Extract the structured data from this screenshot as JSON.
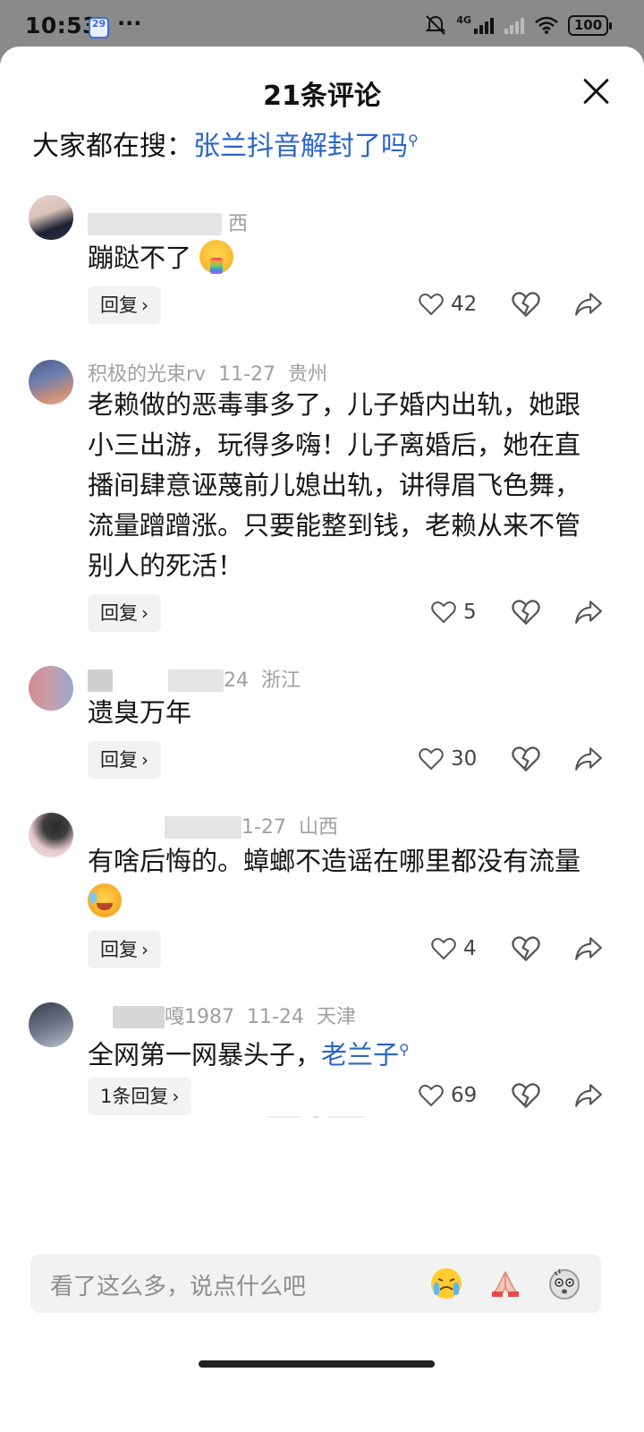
{
  "status_bar": {
    "time": "10:53",
    "calendar_day": "29",
    "dots": "···",
    "network": "4G",
    "battery": "100"
  },
  "sheet": {
    "title": "21条评论"
  },
  "hot_search": {
    "prefix": "大家都在搜：",
    "term": "张兰抖音解封了吗"
  },
  "comments": [
    {
      "meta_visible": "西",
      "text": "蹦跶不了",
      "reply_label": "回复",
      "likes": "42"
    },
    {
      "name_visible": "积极的光束rv",
      "date": "11-27",
      "location": "贵州",
      "text": "老赖做的恶毒事多了，儿子婚内出轨，她跟小三出游，玩得多嗨！儿子离婚后，她在直播间肆意诬蔑前儿媳出轨，讲得眉飞色舞，流量蹭蹭涨。只要能整到钱，老赖从来不管别人的死活！",
      "reply_label": "回复",
      "likes": "5"
    },
    {
      "date": "24",
      "location": "浙江",
      "text": "遗臭万年",
      "reply_label": "回复",
      "likes": "30"
    },
    {
      "date": "1-27",
      "location": "山西",
      "text": "有啥后悔的。蟑螂不造谣在哪里都没有流量",
      "reply_label": "回复",
      "likes": "4"
    },
    {
      "name_visible": "嘎1987",
      "date": "11-24",
      "location": "天津",
      "text_plain": "全网第一网暴头子，",
      "text_link": "老兰子",
      "reply_label": "1条回复",
      "likes": "69"
    }
  ],
  "input": {
    "placeholder": "看了这么多，说点什么吧"
  },
  "colors": {
    "link": "#2a64c8",
    "muted": "#a0a0a0",
    "button_bg": "#f2f2f2"
  }
}
